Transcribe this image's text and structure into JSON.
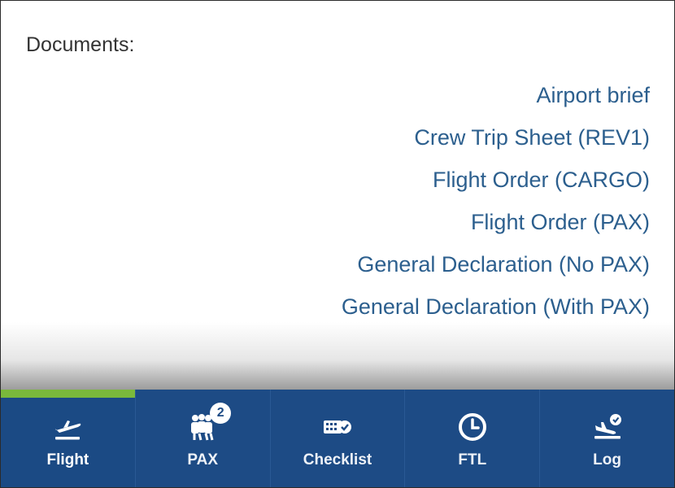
{
  "documents": {
    "heading": "Documents:",
    "items": [
      {
        "label": "Airport brief"
      },
      {
        "label": "Crew Trip Sheet (REV1)"
      },
      {
        "label": "Flight Order (CARGO)"
      },
      {
        "label": "Flight Order (PAX)"
      },
      {
        "label": "General Declaration (No PAX)"
      },
      {
        "label": "General Declaration (With PAX)"
      }
    ]
  },
  "tabbar": {
    "tabs": [
      {
        "label": "Flight",
        "icon": "takeoff-icon",
        "active": true
      },
      {
        "label": "PAX",
        "icon": "passengers-icon",
        "badge": "2"
      },
      {
        "label": "Checklist",
        "icon": "checklist-icon"
      },
      {
        "label": "FTL",
        "icon": "clock-icon"
      },
      {
        "label": "Log",
        "icon": "landing-check-icon"
      }
    ]
  },
  "colors": {
    "tabbar_bg": "#1d4b85",
    "active_indicator": "#7ab93b",
    "link": "#2c5f8e",
    "heading": "#333333"
  }
}
